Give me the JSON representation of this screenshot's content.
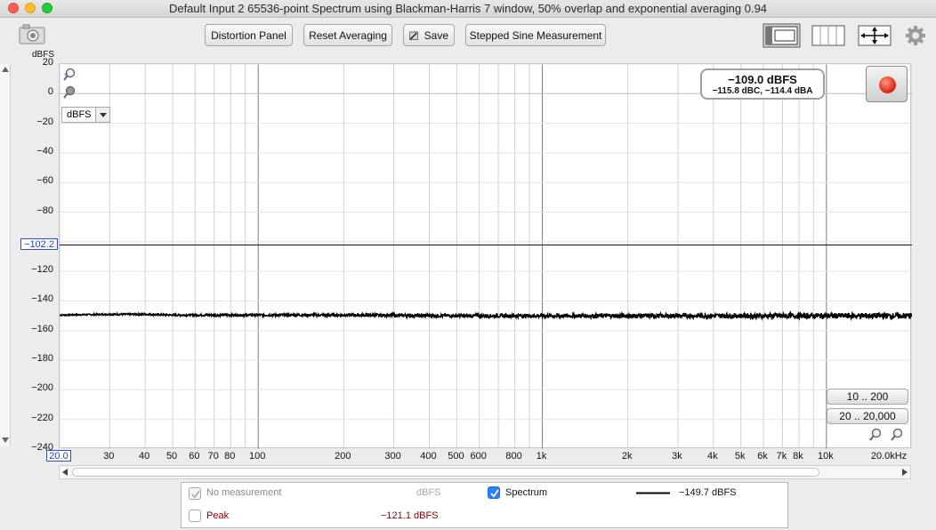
{
  "window": {
    "title": "Default Input 2 65536-point Spectrum using Blackman-Harris 7 window, 50% overlap and exponential averaging 0.94"
  },
  "toolbar": {
    "distortion_panel": "Distortion Panel",
    "reset_averaging": "Reset Averaging",
    "save": "Save",
    "stepped_sine": "Stepped Sine Measurement"
  },
  "plot": {
    "y_unit_label": "dBFS",
    "y_ticks": [
      "20",
      "0",
      "−20",
      "−40",
      "−60",
      "−80",
      "−120",
      "−140",
      "−160",
      "−180",
      "−200",
      "−220",
      "−240"
    ],
    "cursor_level": "−102.2",
    "x_start": "20.0",
    "x_ticks": [
      "30",
      "40",
      "50",
      "60",
      "70",
      "80",
      "100",
      "200",
      "300",
      "400",
      "500",
      "600",
      "800",
      "1k",
      "2k",
      "3k",
      "4k",
      "5k",
      "6k",
      "7k",
      "8k",
      "10k",
      "20.0kHz"
    ],
    "unit_select": "dBFS",
    "range_buttons": [
      "10 .. 200",
      "20 .. 20,000"
    ]
  },
  "readout": {
    "main": "−109.0 dBFS",
    "sub": "−115.8 dBC, −114.4 dBA"
  },
  "chart_data": {
    "type": "line",
    "xlabel": "",
    "ylabel": "dBFS",
    "x_scale": "log",
    "xlim": [
      20,
      20000
    ],
    "ylim": [
      -240,
      20
    ],
    "reference_line": -102.2,
    "series": [
      {
        "name": "Spectrum",
        "x": [
          20,
          30,
          40,
          50,
          100,
          200,
          500,
          1000,
          2000,
          5000,
          10000,
          20000
        ],
        "y": [
          -149.5,
          -149,
          -149,
          -149.5,
          -149.5,
          -149.5,
          -150,
          -150,
          -150,
          -150,
          -150,
          -150
        ]
      }
    ]
  },
  "legend": {
    "no_measurement": "No measurement",
    "no_measurement_unit": "dBFS",
    "spectrum": "Spectrum",
    "spectrum_value": "−149.7 dBFS",
    "peak": "Peak",
    "peak_value": "−121.1 dBFS",
    "colors": {
      "spectrum": "#000000",
      "peak": "#8b0000"
    }
  }
}
